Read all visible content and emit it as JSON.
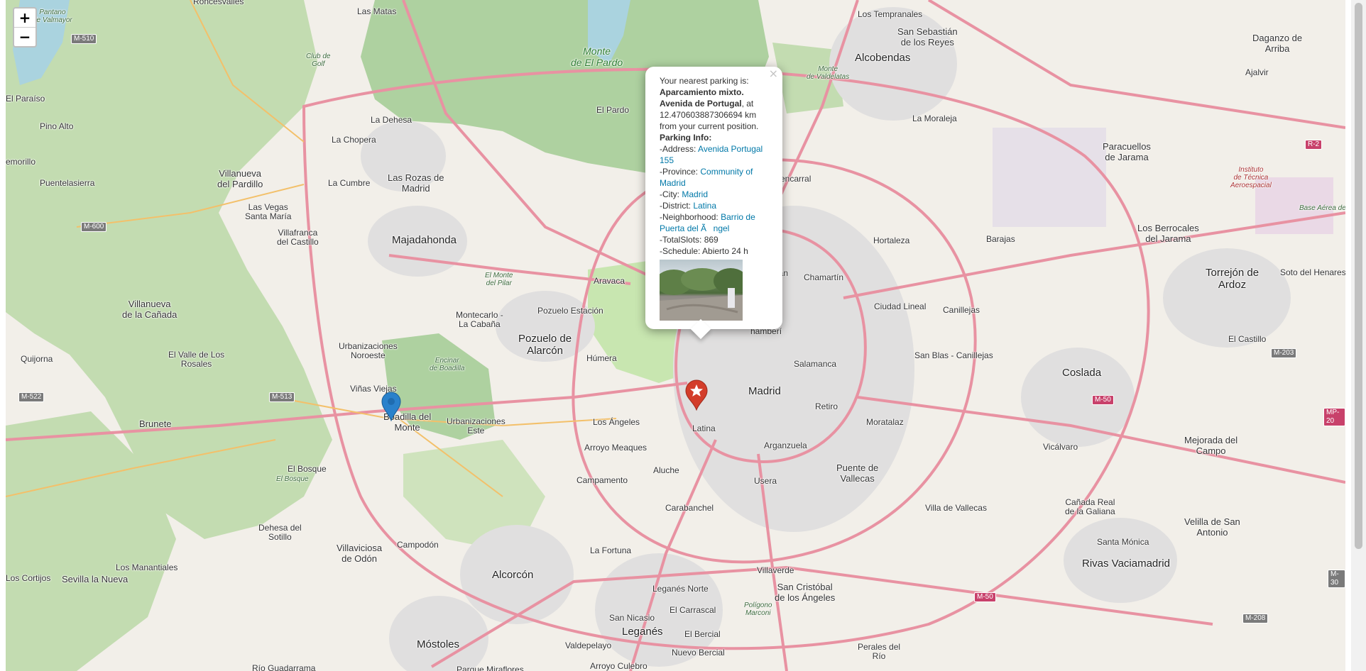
{
  "map": {
    "colors": {
      "land": "#f2efe9",
      "forest": "#aed1a0",
      "park": "#c8e6b0",
      "water": "#aad3df",
      "motorway": "#e892a2",
      "primary": "#fcd6a4",
      "urban": "#e0dfdf"
    },
    "zoom_in": "+",
    "zoom_out": "−",
    "places": {
      "madrid": "Madrid",
      "latina": "Latina",
      "carabanchel": "Carabanchel",
      "usera": "Usera",
      "arganzuela": "Arganzuela",
      "retiro": "Retiro",
      "salamanca": "Salamanca",
      "chamartin": "Chamartín",
      "tetuan": "Tetuán",
      "hortaleza": "Hortaleza",
      "barajas": "Barajas",
      "ciudad_lineal": "Ciudad Lineal",
      "canillejas": "Canillejas",
      "san_blas": "San Blas - Canillejas",
      "moratalaz": "Moratalaz",
      "puente_vallecas": "Puente de\nVallecas",
      "villa_vallecas": "Villa de Vallecas",
      "villaverde": "Villaverde",
      "san_cristobal": "San Cristóbal\nde los Ángeles",
      "fuencarral": "Fuencarral",
      "el_pardo": "El Pardo",
      "monte_pardo": "Monte\nde El Pardo",
      "alcobendas": "Alcobendas",
      "san_sebastian": "San Sebastián\nde los Reyes",
      "moraleja": "La Moraleja",
      "los_tempranales": "Los Tempranales",
      "paracuellos": "Paracuellos\nde Jarama",
      "daganzo": "Daganzo de\nArriba",
      "ajalvir": "Ajalvir",
      "torrejon": "Torrejón de\nArdoz",
      "soto_henares": "Soto del Henares",
      "los_berrocales": "Los Berrocales\ndel Jarama",
      "base_aerea": "Base Aérea de Torrejón",
      "el_castillo": "El Castillo",
      "coslada": "Coslada",
      "vicalvaro": "Vicálvaro",
      "mejorada": "Mejorada del\nCampo",
      "canada_real": "Cañada Real\nde la Galiana",
      "santa_monica": "Santa Mónica",
      "rivas": "Rivas Vaciamadrid",
      "velilla": "Velilla de San\nAntonio",
      "perales": "Perales del\nRío",
      "leganes": "Leganés",
      "leganes_norte": "Leganés Norte",
      "san_nicasio": "San Nicasio",
      "el_carrascal": "El Carrascal",
      "el_bercial": "El Bercial",
      "nuevo_bercial": "Nuevo Bercial",
      "valdepelayo": "Valdepelayo",
      "alcorcon": "Alcorcón",
      "mostoles": "Móstoles",
      "la_fortuna": "La Fortuna",
      "campamento": "Campamento",
      "aluche": "Aluche",
      "arroyo_meaques": "Arroyo Meaques",
      "los_angeles": "Los Ángeles",
      "humera": "Húmera",
      "pozuelo": "Pozuelo de\nAlarcón",
      "pozuelo_est": "Pozuelo Estación",
      "aravaca": "Aravaca",
      "montecarlo": "Montecarlo -\nLa Cabaña",
      "majadahonda": "Majadahonda",
      "las_rozas": "Las Rozas de\nMadrid",
      "la_chopera": "La Chopera",
      "la_cumbre": "La Cumbre",
      "la_dehesa": "La Dehesa",
      "las_matas": "Las Matas",
      "villanueva_pardillo": "Villanueva\ndel Pardillo",
      "las_vegas": "Las Vegas\nSanta María",
      "villafranca": "Villafranca\ndel Castillo",
      "pino_alto": "Pino Alto",
      "puentelasierra": "Puentelasierra",
      "el_paraiso": "El Paraíso",
      "romerillo": "emorillo",
      "villanueva_canada": "Villanueva\nde la Cañada",
      "quijorna": "Quijorna",
      "brunete": "Brunete",
      "el_valle": "El Valle de Los\nRosales",
      "urb_noroeste": "Urbanizaciones\nNoroeste",
      "vinas_viejas": "Viñas Viejas",
      "boadilla": "Boadilla del\nMonte",
      "urb_este": "Urbanizaciones\nEste",
      "el_bosque": "El Bosque",
      "el_bosque2": "El Bosque",
      "dehesa_sotillo": "Dehesa del\nSotillo",
      "villaviciosa": "Villaviciosa\nde Odón",
      "campodon": "Campodón",
      "los_cortijos": "Los Cortijos",
      "sevilla_nueva": "Sevilla la Nueva",
      "los_manantiales": "Los Manantiales",
      "rio_guadarrama": "Río Guadarrama",
      "parque_miraflores": "Parque Miraflores",
      "arroyo_culebro": "Arroyo Culebro",
      "monte_valdelatas": "Monte\nde Valdelatas",
      "club_golf": "Club de\nGolf",
      "el_monte_pilar": "El Monte\ndel Pilar",
      "encinar": "Encinar\nde Boadilla",
      "chamberi": "hamberí",
      "instituto": "Instituto\nde Técnica\nAeroespacial",
      "poligono_marconi": "Polígono\nMarconi",
      "roncesvalles": "Roncesvalles",
      "pantano": "Pantano\nde Valmayor"
    },
    "roads": {
      "m510": "M-510",
      "m600": "M-600",
      "m513": "M-513",
      "m522": "M-522",
      "m50a": "M-50",
      "m50b": "M-50",
      "m203": "M-203",
      "m208": "M-208",
      "r2": "R-2",
      "mp20": "MP-20",
      "m30": "M-30"
    }
  },
  "popup": {
    "close": "×",
    "intro": "Your nearest parking is: ",
    "name": "Aparcamiento mixto. Avenida de Portugal",
    "distance_text": ", at 12.470603887306694 km from your current position.",
    "info_title": "Parking Info:",
    "address_label": "-Address: ",
    "address": "Avenida Portugal 155",
    "province_label": "-Province: ",
    "province": "Community of Madrid",
    "city_label": "-City: ",
    "city": "Madrid",
    "district_label": "-District: ",
    "district": "Latina",
    "neighborhood_label": "-Neighborhood: ",
    "neighborhood": "Barrio de Puerta del Ãngel",
    "totalslots": "-TotalSlots: 869",
    "schedule": "-Schedule: Abierto 24 h"
  }
}
